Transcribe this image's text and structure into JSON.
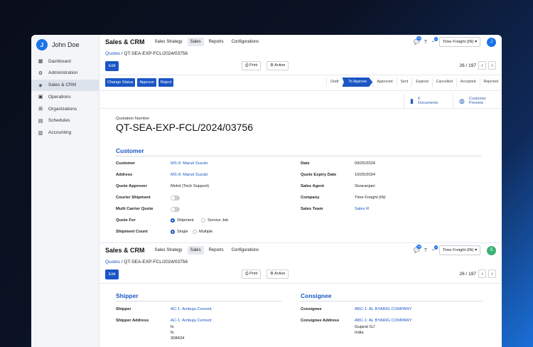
{
  "sidebar": {
    "user_name": "John Doe",
    "avatar_initial": "J",
    "items": [
      {
        "label": "Dashboard",
        "icon": "grid-icon"
      },
      {
        "label": "Administration",
        "icon": "gear-icon"
      },
      {
        "label": "Sales & CRM",
        "icon": "tag-icon"
      },
      {
        "label": "Operations",
        "icon": "truck-icon"
      },
      {
        "label": "Organizations",
        "icon": "org-icon"
      },
      {
        "label": "Schedules",
        "icon": "calendar-icon"
      },
      {
        "label": "Accounting",
        "icon": "ledger-icon"
      }
    ]
  },
  "topbar": {
    "title": "Sales & CRM",
    "tabs": [
      "Sales Strategy",
      "Sales",
      "Reports",
      "Configurations"
    ],
    "active_tab": "Sales",
    "chat_badge": "99",
    "activity_badge": "2",
    "company": "Time Freight (IN)",
    "avatar_initial": "J"
  },
  "breadcrumb": {
    "parent": "Quotes",
    "separator": " / ",
    "current": "QT-SEA-EXP-FCL/2024/03756"
  },
  "actions": {
    "edit": "Edit",
    "print": "Print",
    "action": "Action",
    "pager": "26 / 197"
  },
  "status_buttons": [
    "Change Status",
    "Approve",
    "Reject"
  ],
  "stages": [
    "Draft",
    "To Approve",
    "Approved",
    "Sent",
    "Expired",
    "Cancelled",
    "Accepted",
    "Rejected"
  ],
  "active_stage": "To Approve",
  "smart_buttons": {
    "documents_count": "6",
    "documents_label": "Documents",
    "preview_line1": "Customer",
    "preview_line2": "Preview"
  },
  "quotation": {
    "label": "Quotation Number",
    "number": "QT-SEA-EXP-FCL/2024/03756"
  },
  "customer_section": {
    "title": "Customer",
    "left": [
      {
        "label": "Customer",
        "value": "MS-9: Maruti Suzuki",
        "link": true
      },
      {
        "label": "Address",
        "value": "MS-9: Maruti Suzuki",
        "link": true
      },
      {
        "label": "Quote Approver",
        "value": "Mohd (Tech Support)",
        "link": false
      },
      {
        "label": "Courier Shipment",
        "value": "",
        "link": false
      },
      {
        "label": "Multi Carrier Quote",
        "value": "",
        "link": false
      },
      {
        "label": "Quote For",
        "value": "",
        "link": false
      },
      {
        "label": "Shipment Count",
        "value": "",
        "link": false
      }
    ],
    "right": [
      {
        "label": "Date",
        "value": "09/25/2024",
        "link": false
      },
      {
        "label": "Quote Expiry Date",
        "value": "10/25/2024",
        "link": false
      },
      {
        "label": "Sales Agent",
        "value": "Sivaranjani",
        "link": false
      },
      {
        "label": "Company",
        "value": "Time Freight (IN)",
        "link": false
      },
      {
        "label": "Sales Team",
        "value": "Sales R",
        "link": true
      }
    ],
    "quote_for_options": [
      "Shipment",
      "Service Job"
    ],
    "quote_for_selected": 0,
    "shipment_count_options": [
      "Single",
      "Multiple"
    ],
    "shipment_count_selected": 0
  },
  "second": {
    "avatar_initial": "S",
    "shipper_title": "Shipper",
    "consignee_title": "Consignee",
    "shipper": {
      "label": "Shipper",
      "value": "AC-1: Ambuja Cement"
    },
    "shipper_address": {
      "label": "Shipper Address",
      "value": "AC-1: Ambuja Cement",
      "lines": [
        "fs",
        "fs",
        "308434"
      ]
    },
    "consignee": {
      "label": "Consignee",
      "value": "ABC-1: AL BYARIG COMPANY"
    },
    "consignee_address": {
      "label": "Consignee Address",
      "value": "ABC-1: AL BYARIG COMPANY",
      "lines": [
        "Gujarat GJ",
        "India"
      ]
    }
  }
}
